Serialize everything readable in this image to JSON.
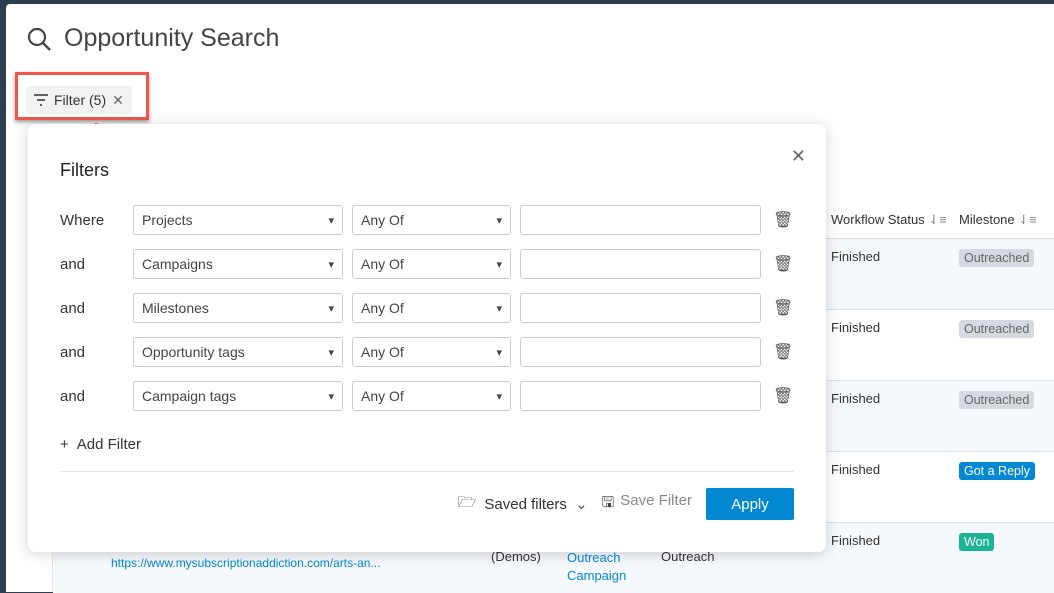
{
  "header": {
    "title": "Opportunity Search",
    "filter_chip": "Filter (5)"
  },
  "table": {
    "columns": [
      {
        "label": "Workflow Status"
      },
      {
        "label": "Milestone"
      }
    ],
    "rows": [
      {
        "workflow_status": "Finished",
        "milestone": "Outreached",
        "milestone_color": "#d4dadf"
      },
      {
        "workflow_status": "Finished",
        "milestone": "Outreached",
        "milestone_color": "#d4dadf"
      },
      {
        "workflow_status": "Finished",
        "milestone": "Outreached",
        "milestone_color": "#d4dadf"
      },
      {
        "workflow_status": "Finished",
        "milestone": "Got a Reply",
        "milestone_color": "#0288d1"
      },
      {
        "workflow_status": "Finished",
        "milestone": "Won",
        "milestone_color": "#1ab394",
        "url": "https://www.mysubscriptionaddiction.com/arts-an...",
        "project": "(Demos)",
        "campaign": "Outreach Campaign",
        "type": "Outreach"
      }
    ]
  },
  "filters": {
    "title": "Filters",
    "rows": [
      {
        "conj": "Where",
        "field": "Projects",
        "op": "Any Of",
        "value": ""
      },
      {
        "conj": "and",
        "field": "Campaigns",
        "op": "Any Of",
        "value": ""
      },
      {
        "conj": "and",
        "field": "Milestones",
        "op": "Any Of",
        "value": ""
      },
      {
        "conj": "and",
        "field": "Opportunity tags",
        "op": "Any Of",
        "value": ""
      },
      {
        "conj": "and",
        "field": "Campaign tags",
        "op": "Any Of",
        "value": ""
      }
    ],
    "add_filter": "Add Filter",
    "saved_filters": "Saved filters",
    "save_filter": "Save Filter",
    "apply": "Apply"
  },
  "colors": {
    "accent": "#0288d1",
    "annotation": "#f0564a"
  }
}
